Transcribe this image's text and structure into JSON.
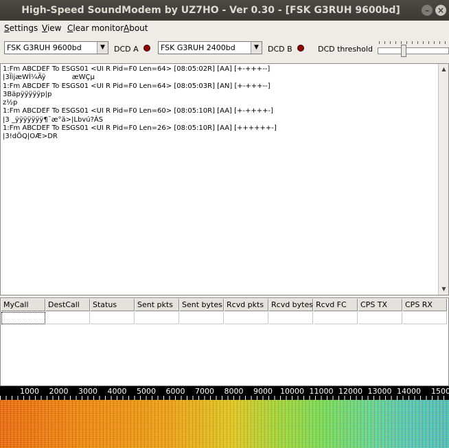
{
  "window": {
    "title": "High-Speed SoundModem by UZ7HO - Ver 0.30 - [FSK G3RUH 9600bd]",
    "min_glyph": "–",
    "close_glyph": "×"
  },
  "menu": [
    {
      "first": "S",
      "rest": "ettings"
    },
    {
      "first": "V",
      "rest": "iew"
    },
    {
      "first": "C",
      "rest": "lear monitor"
    },
    {
      "first": "A",
      "rest": "bout"
    }
  ],
  "toolbar": {
    "modem_a": "FSK G3RUH 9600bd",
    "dcd_a_label": "DCD A",
    "modem_b": "FSK G3RUH 2400bd",
    "dcd_b_label": "DCD B",
    "dcd_threshold_label": "DCD threshold",
    "dcd_threshold_value": 0.35,
    "led_color": "#8b0000",
    "combo_arrow": "▼"
  },
  "monitor": {
    "lines": [
      "1:Fm ABCDEF To ESGS01 <UI R Pid=F0 Len=64> [08:05:02R] [AA] [+-+++--]",
      "|3ÏijæWÌ¼Äÿ            æWÇµ",
      "1:Fm ABCDEF To ESGS01 <UI R Pid=F0 Len=64> [08:05:03R] [AN] [+-+++--]",
      "3Bäpÿÿÿÿÿp|p",
      "z½p",
      "1:Fm ABCDEF To ESGS01 <UI R Pid=F0 Len=60> [08:05:10R] [AA] [+-++++-]",
      "|3 _ÿÿÿÿÿÿÿ¶¯æ°ä>|Lbvú?ÀS",
      "1:Fm ABCDEF To ESGS01 <UI R Pid=F0 Len=26> [08:05:10R] [AA] [++++++-]",
      "|3!dÖQ|OÆ>DR"
    ],
    "scroll_up": "▲",
    "scroll_down": "▼"
  },
  "grid": {
    "columns": [
      "MyCall",
      "DestCall",
      "Status",
      "Sent pkts",
      "Sent bytes",
      "Rcvd pkts",
      "Rcvd bytes",
      "Rcvd FC",
      "CPS TX",
      "CPS RX"
    ]
  },
  "ruler": {
    "labels": [
      "1000",
      "2000",
      "3000",
      "4000",
      "5000",
      "6000",
      "7000",
      "8000",
      "9000",
      "10000",
      "11000",
      "12000",
      "13000",
      "14000",
      "1500"
    ]
  }
}
